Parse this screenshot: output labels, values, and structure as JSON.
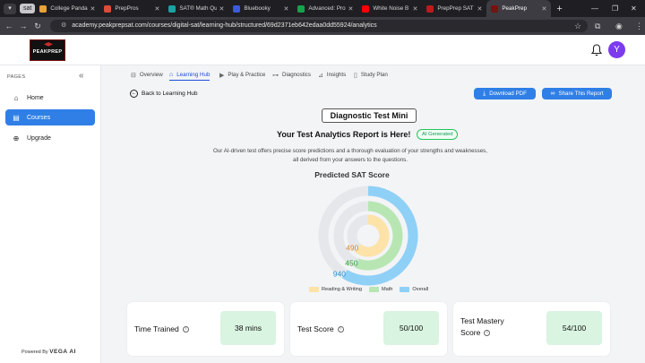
{
  "browser": {
    "group_label": "sat",
    "tabs": [
      {
        "title": "College Panda",
        "color": "#e8a33a"
      },
      {
        "title": "PrepPros",
        "color": "#dd4b39"
      },
      {
        "title": "SAT® Math Qu",
        "color": "#1aa3a3"
      },
      {
        "title": "Bluebooky",
        "color": "#3b5bdb"
      },
      {
        "title": "Advanced: Prob",
        "color": "#16a34a"
      },
      {
        "title": "White Noise B",
        "color": "#ff0000"
      },
      {
        "title": "PrepPrep SAT",
        "color": "#b91c1c"
      },
      {
        "title": "PeakPrep",
        "color": "#7a1010"
      }
    ],
    "url": "academy.peakprepsat.com/courses/digital-sat/learning-hub/structured/69d2371eb642edaa0dd55924/analytics"
  },
  "header": {
    "logo_text": "PEAKPREP",
    "avatar_initial": "Y"
  },
  "sidebar": {
    "section_label": "PAGES",
    "items": [
      {
        "label": "Home",
        "icon": "home-icon"
      },
      {
        "label": "Courses",
        "icon": "courses-icon"
      },
      {
        "label": "Upgrade",
        "icon": "upgrade-icon"
      }
    ],
    "powered_prefix": "Powered By",
    "powered_brand": "VEGA AI"
  },
  "subnav": [
    {
      "label": "Overview"
    },
    {
      "label": "Learning Hub"
    },
    {
      "label": "Play & Practice"
    },
    {
      "label": "Diagnostics"
    },
    {
      "label": "Insights"
    },
    {
      "label": "Study Plan"
    }
  ],
  "actions": {
    "back_label": "Back to Learning Hub",
    "download_label": "Download PDF",
    "share_label": "Share This Report"
  },
  "report": {
    "test_name": "Diagnostic Test Mini",
    "heading": "Your Test Analytics Report is Here!",
    "ai_badge": "AI Generated",
    "description_1": "Our AI-driven test offers precise score predictions and a thorough evaluation of your strengths and weaknesses,",
    "description_2": "all derived from your answers to the questions.",
    "predicted_title": "Predicted SAT Score"
  },
  "chart_data": {
    "type": "radial-bar",
    "series": [
      {
        "name": "Overall",
        "value": 940,
        "max": 1600,
        "color": "#8fd0f7"
      },
      {
        "name": "Math",
        "value": 450,
        "max": 800,
        "color": "#b7e6b3"
      },
      {
        "name": "Reading & Writing",
        "value": 490,
        "max": 800,
        "color": "#fde3a7"
      }
    ],
    "label_colors": {
      "Overall": "#2a8fd6",
      "Math": "#2a9d2a",
      "Reading & Writing": "#e0892d"
    },
    "track_color": "#e5e7eb",
    "legend": [
      "Reading & Writing",
      "Math",
      "Overall"
    ]
  },
  "cards": [
    {
      "label": "Time Trained",
      "value": "38 mins"
    },
    {
      "label": "Test Score",
      "value": "50/100"
    },
    {
      "label": "Test Mastery",
      "label2": "Score",
      "value": "54/100"
    }
  ]
}
